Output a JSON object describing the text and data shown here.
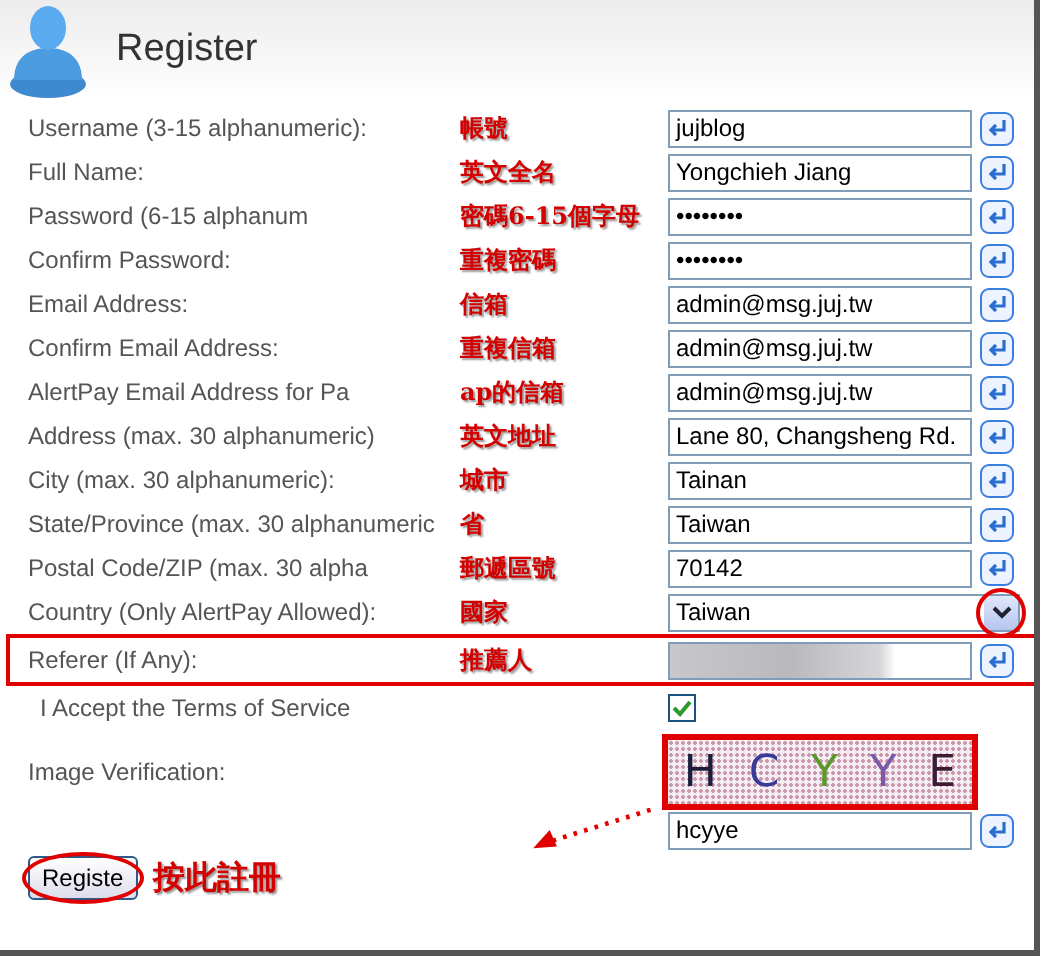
{
  "header": {
    "title": "Register"
  },
  "fields": [
    {
      "kind": "text",
      "label": "Username (3-15 alphanumeric):",
      "note": "帳號",
      "value": "jujblog"
    },
    {
      "kind": "text",
      "label": "Full Name:",
      "note": "英文全名",
      "value": "Yongchieh Jiang"
    },
    {
      "kind": "text",
      "label": "Password (6-15 alphanum",
      "note": "密碼6-15個字母",
      "value": "••••••••"
    },
    {
      "kind": "text",
      "label": "Confirm Password:",
      "note": "重複密碼",
      "value": "••••••••"
    },
    {
      "kind": "text",
      "label": "Email Address:",
      "note": "信箱",
      "value": "admin@msg.juj.tw"
    },
    {
      "kind": "text",
      "label": "Confirm Email Address:",
      "note": "重複信箱",
      "value": "admin@msg.juj.tw"
    },
    {
      "kind": "text",
      "label": "AlertPay Email Address for Pa",
      "note": "ap的信箱",
      "value": "admin@msg.juj.tw"
    },
    {
      "kind": "text",
      "label": "Address (max. 30 alphanumeric)",
      "note": "英文地址",
      "value": "Lane 80, Changsheng Rd."
    },
    {
      "kind": "text",
      "label": "City (max. 30 alphanumeric):",
      "note": "城市",
      "value": "Tainan"
    },
    {
      "kind": "text",
      "label": "State/Province (max. 30 alphanumeric",
      "note": "省",
      "value": "Taiwan"
    },
    {
      "kind": "text",
      "label": "Postal Code/ZIP (max. 30 alpha",
      "note": "郵遞區號",
      "value": "70142"
    },
    {
      "kind": "select",
      "label": "Country (Only AlertPay Allowed):",
      "note": "國家",
      "value": "Taiwan",
      "circled": true
    },
    {
      "kind": "redacted",
      "label": "Referer (If Any):",
      "note": "推薦人",
      "highlighted": true
    },
    {
      "kind": "checkbox",
      "label": "I Accept the Terms of Service",
      "checked": true
    },
    {
      "kind": "captcha",
      "label": "Image Verification:",
      "value": "hcyye",
      "arrow": true,
      "circled": true,
      "code": [
        {
          "char": "H",
          "color": "#1c1c3c"
        },
        {
          "char": "C",
          "color": "#3a3a9a"
        },
        {
          "char": "Y",
          "color": "#5a9a2a"
        },
        {
          "char": "Y",
          "color": "#7a5aa8"
        },
        {
          "char": "E",
          "color": "#3c1c34"
        }
      ]
    }
  ],
  "submit": {
    "label": "Registe",
    "note": "按此註冊",
    "circled": true
  }
}
